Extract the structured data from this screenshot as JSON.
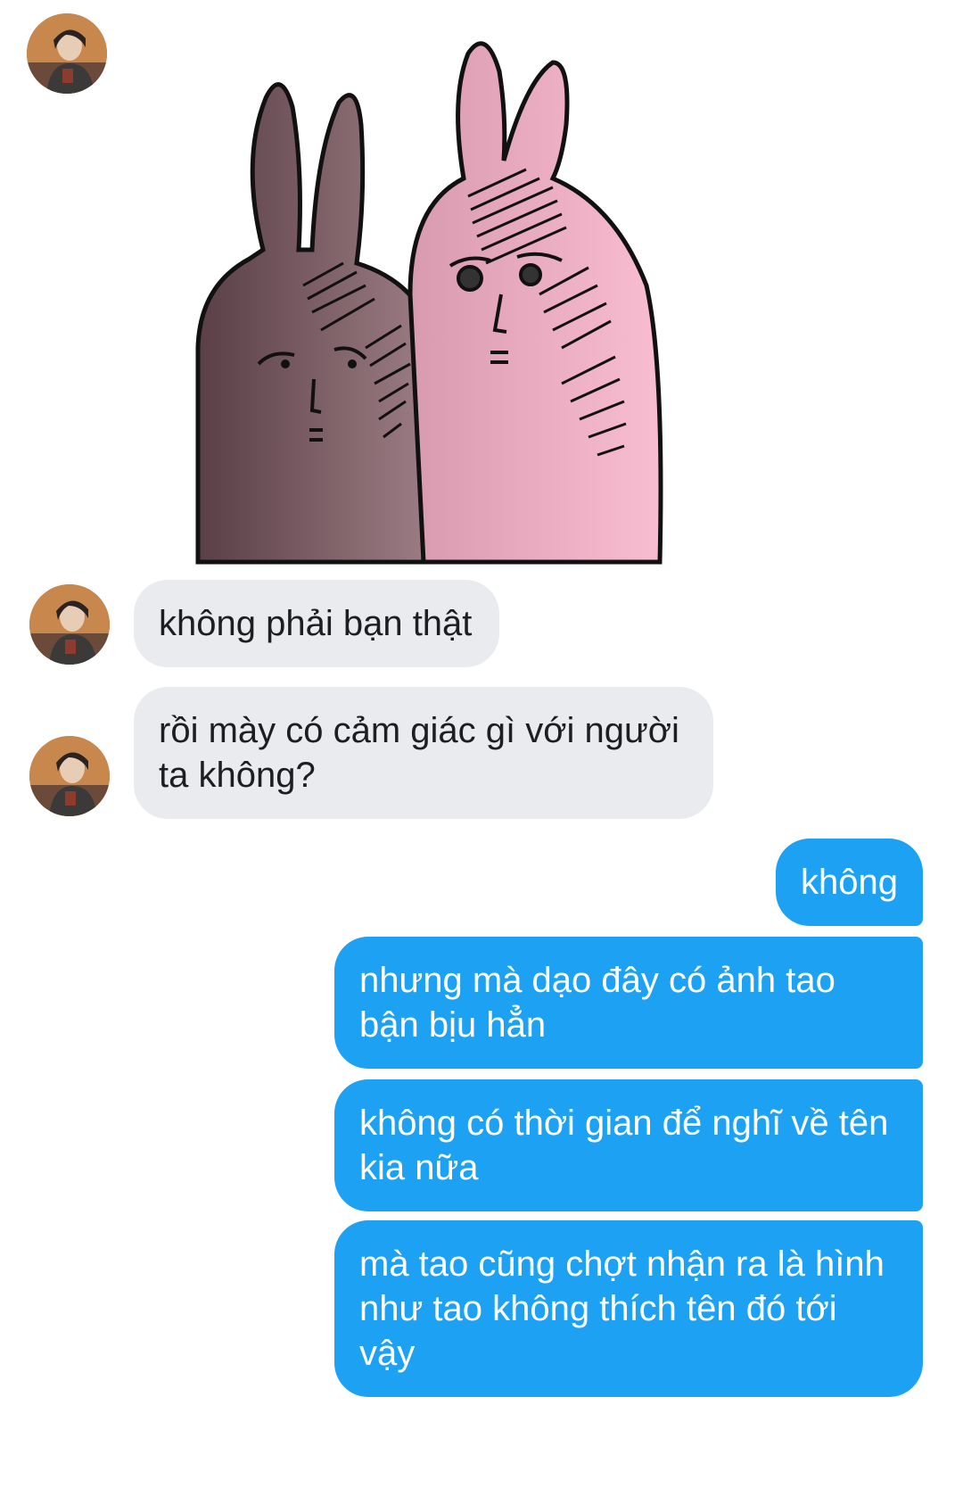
{
  "conversation": {
    "sticker": {
      "description_icon": "two-rabbits-sticker",
      "colors": {
        "left_rabbit": "#6e4f57",
        "right_rabbit": "#f2aac3"
      }
    },
    "messages": [
      {
        "sender": "other",
        "text": "không phải bạn thật"
      },
      {
        "sender": "other",
        "text": "rồi mày có cảm giác gì với người ta không?"
      },
      {
        "sender": "self",
        "text": "không"
      },
      {
        "sender": "self",
        "text": "nhưng mà dạo đây có ảnh tao bận bịu hẳn"
      },
      {
        "sender": "self",
        "text": "không có thời gian để nghĩ về tên kia nữa"
      },
      {
        "sender": "self",
        "text": "mà tao cũng chợt nhận ra là hình như tao không thích tên đó tới vậy"
      }
    ]
  },
  "colors": {
    "self_bubble": "#1da1f2",
    "other_bubble": "#e9ebee",
    "background": "#ffffff"
  }
}
